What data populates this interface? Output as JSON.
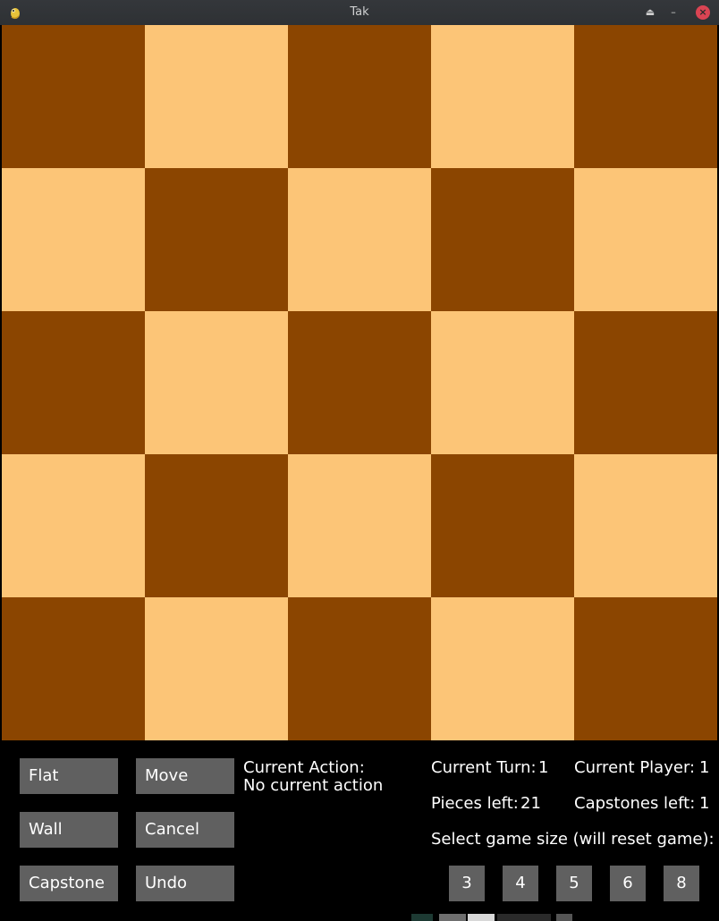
{
  "window": {
    "title": "Tak",
    "app_icon": "pygame-snake-icon",
    "controls": [
      "keep-above-icon",
      "minimize-icon",
      "close-icon"
    ]
  },
  "board": {
    "size": 5,
    "dark_color": "#8b4500",
    "light_color": "#fcc577",
    "top_left": "dark"
  },
  "controls": {
    "flat_label": "Flat",
    "move_label": "Move",
    "wall_label": "Wall",
    "cancel_label": "Cancel",
    "capstone_label": "Capstone",
    "undo_label": "Undo"
  },
  "status": {
    "current_action_label": "Current Action:",
    "current_action_value": "No current action",
    "current_turn_label": "Current Turn:",
    "current_turn_value": "1",
    "current_player_label": "Current Player:",
    "current_player_value": "1",
    "pieces_left_label": "Pieces left:",
    "pieces_left_value": "21",
    "capstones_left_label": "Capstones left:",
    "capstones_left_value": "1",
    "size_prompt": "Select game size (will reset game):"
  },
  "game_sizes": [
    "3",
    "4",
    "5",
    "6",
    "8"
  ],
  "colors": {
    "button_bg": "#606060",
    "panel_bg": "#000000",
    "text": "#ffffff"
  }
}
